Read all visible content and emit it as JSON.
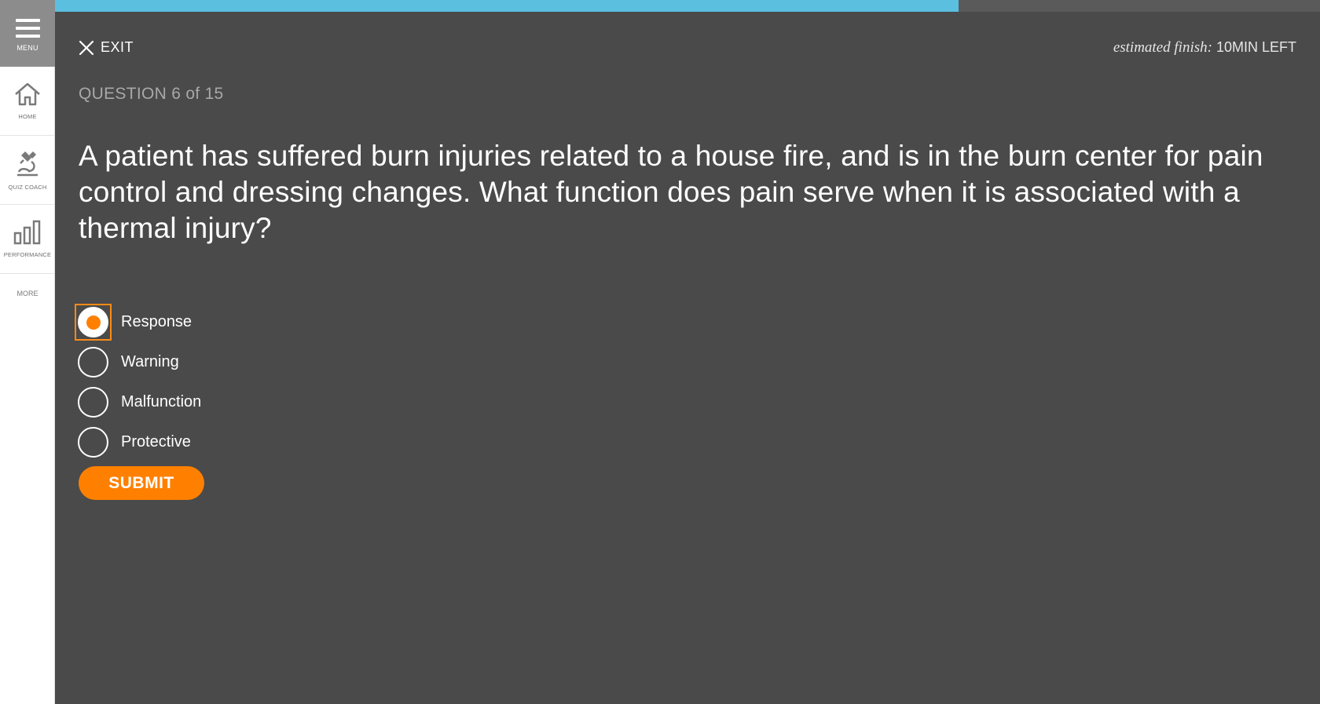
{
  "sidebar": {
    "menu_label": "MENU",
    "items": [
      {
        "label": "HOME",
        "icon": "home-icon"
      },
      {
        "label": "QUIZ COACH",
        "icon": "microscope-icon"
      },
      {
        "label": "PERFORMANCE",
        "icon": "bar-chart-icon"
      }
    ],
    "more_label": "MORE"
  },
  "progress": {
    "fraction": 0.7143,
    "fill_color": "#5bbfe0",
    "track_color": "#5a5a5a"
  },
  "header": {
    "exit_label": "EXIT",
    "estimated_prefix": "estimated finish:",
    "estimated_value": "10MIN LEFT"
  },
  "question": {
    "counter": "QUESTION 6 of 15",
    "text": "A patient has suffered burn injuries related to a house fire, and is in the burn center for pain control and dressing changes. What function does pain serve when it is associated with a thermal injury?"
  },
  "options": [
    {
      "label": "Response",
      "selected": true
    },
    {
      "label": "Warning",
      "selected": false
    },
    {
      "label": "Malfunction",
      "selected": false
    },
    {
      "label": "Protective",
      "selected": false
    }
  ],
  "submit_label": "SUBMIT",
  "colors": {
    "accent": "#ff8000",
    "background": "#4a4a4a",
    "sidebar": "#ffffff"
  }
}
